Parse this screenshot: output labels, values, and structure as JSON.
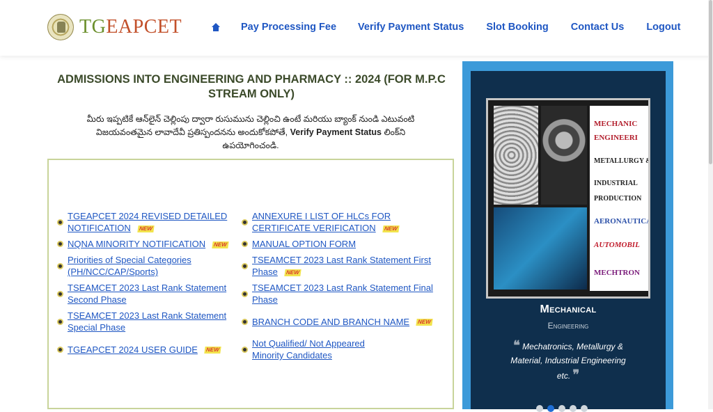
{
  "header": {
    "brand_prefix": "TG",
    "brand_suffix": "EAPCET",
    "nav": [
      {
        "label": "Pay Processing Fee"
      },
      {
        "label": "Verify Payment Status"
      },
      {
        "label": "Slot Booking"
      },
      {
        "label": "Contact Us"
      },
      {
        "label": "Logout"
      }
    ]
  },
  "main": {
    "title": "ADMISSIONS INTO ENGINEERING AND PHARMACY :: 2024  (FOR M.P.C STREAM ONLY)",
    "telugu_before": "మీరు ఇప్పటికే ఆన్‌లైన్ చెల్లింపు ద్వారా రుసుమును చెల్లించి ఉంటే మరియు బ్యాంక్ నుండి ఎటువంటి విజయవంతమైన లావాదేవీ ప్రతిస్పందనను అందుకోకపోతే,",
    "telugu_link": "Verify Payment Status",
    "telugu_after": "లింక్‌ని ఉపయోగించండి.",
    "new_badge": "NEW",
    "links": [
      {
        "label": "TGEAPCET 2024 REVISED DETAILED NOTIFICATION",
        "new": true
      },
      {
        "label": "ANNEXURE I LIST OF HLCs FOR CERTIFICATE VERIFICATION",
        "new": true
      },
      {
        "label": "NQNA MINORITY NOTIFICATION",
        "new": true
      },
      {
        "label": "MANUAL OPTION FORM",
        "new": false
      },
      {
        "label": "Priorities of Special Categories (PH/NCC/CAP/Sports)",
        "new": false
      },
      {
        "label": "TSEAMCET 2023 Last Rank Statement First Phase",
        "new": true
      },
      {
        "label": "TSEAMCET 2023 Last Rank Statement Second Phase",
        "new": false
      },
      {
        "label": "TSEAMCET 2023 Last Rank Statement Final Phase",
        "new": false
      },
      {
        "label": "TSEAMCET 2023 Last Rank Statement Special Phase",
        "new": false
      },
      {
        "label": "BRANCH CODE AND BRANCH NAME",
        "new": true
      },
      {
        "label": "TGEAPCET 2024 USER GUIDE",
        "new": true
      },
      {
        "label": "Not Qualified/ Not Appeared Minority Candidates",
        "new": false
      }
    ]
  },
  "carousel": {
    "image_text": [
      "MECHANIC",
      "ENGINEERI",
      "METALLURGY & MA",
      "INDUSTRIAL",
      "PRODUCTION",
      "AERONAUTICAL",
      "AUTOMOBIL",
      "MECHTRON"
    ],
    "caption_title": "Mechanical",
    "caption_subtitle": "Engineering",
    "quote": "Mechatronics, Metallurgy & Material, Industrial Engineering etc.",
    "slides": 5,
    "active_slide": 2
  },
  "colors": {
    "nav_link": "#1f57c3",
    "panel_bg": "#0f2f4d",
    "panel_border": "#3c9ad9",
    "box_border": "#c8d49a"
  }
}
